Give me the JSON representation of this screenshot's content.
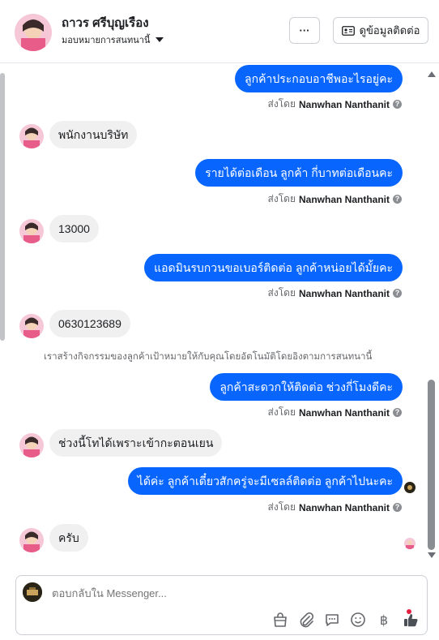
{
  "header": {
    "contact_name": "ถาวร ศรีบุญเรือง",
    "assign_label": "มอบหมายการสนทนานี้",
    "more_label": "···",
    "contact_info_label": "ดูข้อมูลติดต่อ"
  },
  "messages": [
    {
      "dir": "out",
      "text": "ลูกค้าประกอบอาชีพอะไรอยู่คะ",
      "sender_prefix": "ส่งโดย",
      "sender": "Nanwhan Nanthanit"
    },
    {
      "dir": "in",
      "text": "พนักงานบริษัท"
    },
    {
      "dir": "out",
      "text": "รายได้ต่อเดือน ลูกค้า กี่บาทต่อเดือนคะ",
      "sender_prefix": "ส่งโดย",
      "sender": "Nanwhan Nanthanit"
    },
    {
      "dir": "in",
      "text": "13000"
    },
    {
      "dir": "out",
      "text": "แอดมินรบกวนขอเบอร์ติดต่อ ลูกค้าหน่อยได้มั้ยคะ",
      "sender_prefix": "ส่งโดย",
      "sender": "Nanwhan Nanthanit"
    },
    {
      "dir": "in",
      "text": "0630123689"
    },
    {
      "dir": "out",
      "text": "ลูกค้าสะดวกให้ติดต่อ ช่วงกี่โมงดีคะ",
      "sender_prefix": "ส่งโดย",
      "sender": "Nanwhan Nanthanit"
    },
    {
      "dir": "in",
      "text": "ช่วงนี้โทได้เพราะเข้ากะตอนเยน"
    },
    {
      "dir": "out",
      "text": "ได้ค่ะ ลูกค้าเดี๋ยวสักครู่จะมีเซลล์ติดต่อ ลูกค้าไปนะคะ",
      "sender_prefix": "ส่งโดย",
      "sender": "Nanwhan Nanthanit"
    },
    {
      "dir": "in",
      "text": "ครับ"
    }
  ],
  "system_note": "เราสร้างกิจกรรมของลูกค้าเป้าหมายให้กับคุณโดยอัตโนมัติโดยอิงตามการสนทนานี้",
  "composer": {
    "placeholder": "ตอบกลับใน Messenger..."
  },
  "colors": {
    "outgoing_bubble": "#0866ff",
    "incoming_bubble": "#f0f0f0",
    "notification_dot": "#e41e3f"
  },
  "icons": [
    "more-icon",
    "contact-card-icon",
    "bag-icon",
    "paperclip-icon",
    "saved-reply-icon",
    "emoji-icon",
    "baht-icon",
    "thumbs-up-icon"
  ]
}
